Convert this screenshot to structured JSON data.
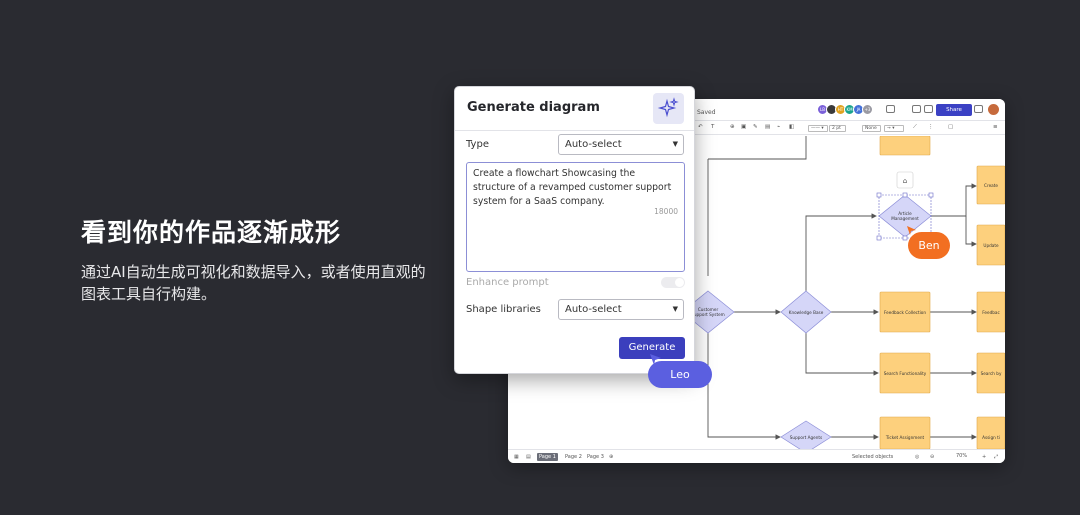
{
  "hero": {
    "headline": "看到你的作品逐渐成形",
    "subtext": "通过AI自动生成可视化和数据导入，或者使用直观的图表工具自行构建。"
  },
  "editor": {
    "saved_label": "Saved",
    "share_label": "Share",
    "avatars": [
      {
        "initials": "LB",
        "color": "#7b61d9"
      },
      {
        "initials": "",
        "color": "#3a3a3a"
      },
      {
        "initials": "HT",
        "color": "#e0a21f"
      },
      {
        "initials": "KM",
        "color": "#1aa38c"
      },
      {
        "initials": "JA",
        "color": "#4470d8"
      },
      {
        "initials": "+3",
        "color": "#9a9aa3"
      }
    ],
    "toolbar": {
      "text_tool": "T",
      "font_size": "2 pt",
      "line_none": "None"
    },
    "pages": [
      "Page 1",
      "Page 2",
      "Page 3"
    ],
    "status": "Selected objects",
    "zoom": "70%"
  },
  "diagram": {
    "nodes": {
      "create": "Create",
      "update": "Update",
      "article_mgmt": "Article Management",
      "customer_support": "Customer Support System",
      "knowledge_base": "Knowledge Base",
      "feedback_collection": "Feedback Collection",
      "feedback": "Feedbac",
      "search_functionality": "Search Functionality",
      "search_by": "Search by",
      "support_agents": "Support Agents",
      "ticket_assignment": "Ticket Assignment",
      "assign": "Assign ti"
    },
    "colors": {
      "process": "#fdd07d",
      "decision": "#d5d6f8",
      "stroke": "#555555"
    }
  },
  "dialog": {
    "title": "Generate diagram",
    "type_label": "Type",
    "type_value": "Auto-select",
    "prompt_text": "Create a flowchart Showcasing the structure of a revamped customer support system for a SaaS company.",
    "prompt_count": "18000",
    "enhance_label": "Enhance prompt",
    "shape_label": "Shape libraries",
    "shape_value": "Auto-select",
    "generate_label": "Generate"
  },
  "cursors": {
    "leo": {
      "name": "Leo",
      "color": "#5b5fe0"
    },
    "ben": {
      "name": "Ben",
      "color": "#f26f21"
    }
  }
}
